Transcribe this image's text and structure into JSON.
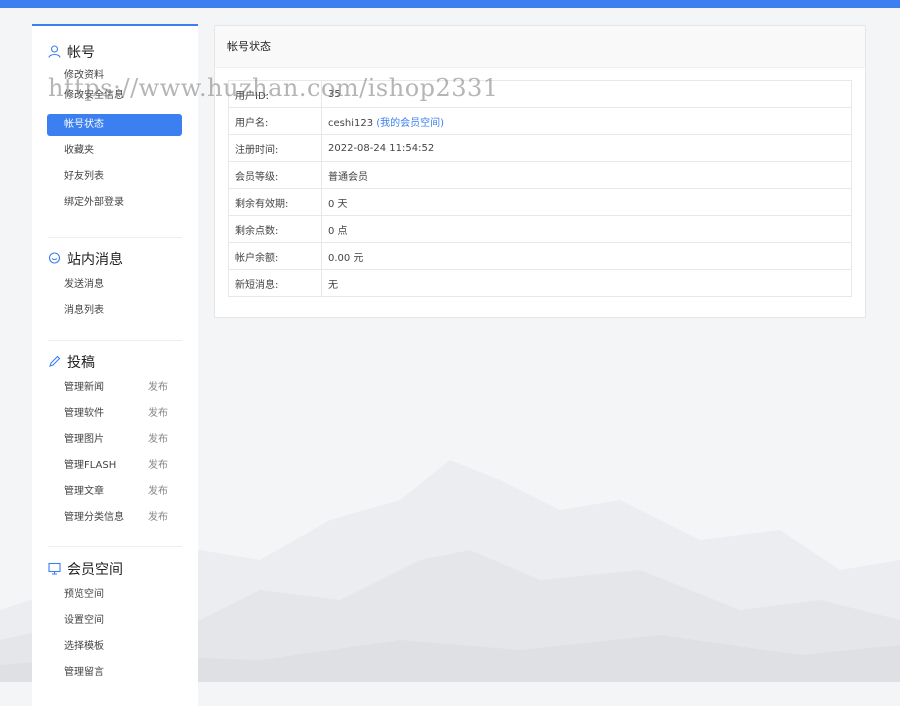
{
  "sidebar": {
    "account": {
      "title": "帐号",
      "items": [
        "修改资料",
        "修改安全信息",
        "帐号状态",
        "收藏夹",
        "好友列表",
        "绑定外部登录"
      ]
    },
    "messages": {
      "title": "站内消息",
      "items": [
        "发送消息",
        "消息列表"
      ]
    },
    "submit": {
      "title": "投稿",
      "items": [
        {
          "label": "管理新闻",
          "action": "发布"
        },
        {
          "label": "管理软件",
          "action": "发布"
        },
        {
          "label": "管理图片",
          "action": "发布"
        },
        {
          "label": "管理FLASH",
          "action": "发布"
        },
        {
          "label": "管理文章",
          "action": "发布"
        },
        {
          "label": "管理分类信息",
          "action": "发布"
        }
      ]
    },
    "space": {
      "title": "会员空间",
      "items": [
        "预览空间",
        "设置空间",
        "选择模板",
        "管理留言"
      ]
    }
  },
  "panel": {
    "title": "帐号状态",
    "rows": [
      {
        "key": "用户ID:",
        "value": "35"
      },
      {
        "key": "用户名:",
        "value": "ceshi123",
        "link": "(我的会员空间)"
      },
      {
        "key": "注册时间:",
        "value": "2022-08-24 11:54:52"
      },
      {
        "key": "会员等级:",
        "value": "普通会员"
      },
      {
        "key": "剩余有效期:",
        "value": "0 天"
      },
      {
        "key": "剩余点数:",
        "value": "0 点"
      },
      {
        "key": "帐户余额:",
        "value": "0.00 元"
      },
      {
        "key": "新短消息:",
        "value": "无"
      }
    ]
  },
  "watermark": "https://www.huzhan.com/ishop2331",
  "colors": {
    "accent": "#3b7ff0"
  }
}
